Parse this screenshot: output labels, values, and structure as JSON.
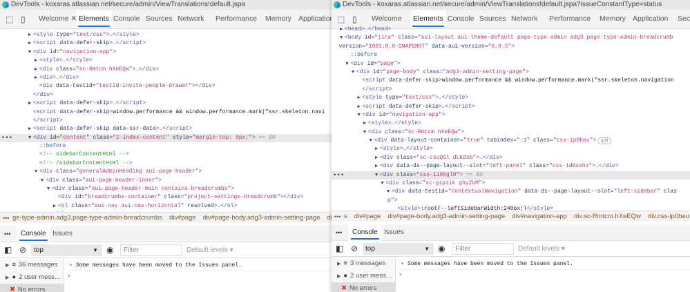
{
  "left": {
    "title": "DevTools - koxaras.atlassian.net/secure/admin/ViewTranslations!default.jspa",
    "tabs": [
      "Welcome",
      "Elements",
      "Console",
      "Sources",
      "Network",
      "Performance",
      "Memory",
      "Application"
    ],
    "active_tab": "Elements",
    "code": [
      {
        "d": 0,
        "a": "r",
        "t": [
          [
            "tag",
            "<style "
          ],
          [
            "attr",
            "type"
          ],
          [
            "tag",
            "=\""
          ],
          [
            "val",
            "text/css"
          ],
          [
            "tag",
            "\">…</style>"
          ]
        ]
      },
      {
        "d": 0,
        "a": "r",
        "t": [
          [
            "tag",
            "<script "
          ],
          [
            "attr",
            "data-defer-skip"
          ],
          [
            "tag",
            ">…</script>"
          ]
        ]
      },
      {
        "d": 0,
        "a": "d",
        "t": [
          [
            "tag",
            "<div "
          ],
          [
            "attr",
            "id"
          ],
          [
            "tag",
            "=\""
          ],
          [
            "val",
            "navigation-app"
          ],
          [
            "tag",
            "\">"
          ]
        ]
      },
      {
        "d": 1,
        "a": "r",
        "t": [
          [
            "tag",
            "<style>…</style>"
          ]
        ]
      },
      {
        "d": 1,
        "a": "r",
        "t": [
          [
            "tag",
            "<div "
          ],
          [
            "attr",
            "class"
          ],
          [
            "tag",
            "=\""
          ],
          [
            "val",
            "sc-Rmtcm hXeEQw"
          ],
          [
            "tag",
            "\">…</div>"
          ]
        ]
      },
      {
        "d": 1,
        "a": "r",
        "t": [
          [
            "tag",
            "<div>…</div>"
          ]
        ]
      },
      {
        "d": 1,
        "a": "",
        "t": [
          [
            "tag",
            "<div "
          ],
          [
            "attr",
            "data-testid"
          ],
          [
            "tag",
            "=\""
          ],
          [
            "val",
            "testId-invite-people-drawer"
          ],
          [
            "tag",
            "\"></div>"
          ]
        ]
      },
      {
        "d": 0,
        "a": "",
        "t": [
          [
            "tag",
            "</div>"
          ]
        ]
      },
      {
        "d": 0,
        "a": "r",
        "t": [
          [
            "tag",
            "<script "
          ],
          [
            "attr",
            "data-defer-skip"
          ],
          [
            "tag",
            ">…</script>"
          ]
        ]
      },
      {
        "d": 0,
        "a": "",
        "t": [
          [
            "tag",
            "<script "
          ],
          [
            "attr",
            "data-defer-skip"
          ],
          [
            "tag",
            ">"
          ],
          [
            "txt",
            "window.performance && window.performance.mark(\"ssr.skeleton.navi"
          ]
        ]
      },
      {
        "d": 0,
        "a": "",
        "t": [
          [
            "tag",
            "</script>"
          ]
        ]
      },
      {
        "d": 0,
        "a": "r",
        "t": [
          [
            "tag",
            "<script "
          ],
          [
            "attr",
            "data-defer-skip data-ssr-data"
          ],
          [
            "tag",
            ">…</script>"
          ]
        ]
      },
      {
        "d": 0,
        "a": "d",
        "sel": true,
        "t": [
          [
            "tag",
            "<div "
          ],
          [
            "attr",
            "id"
          ],
          [
            "tag",
            "=\""
          ],
          [
            "val",
            "content"
          ],
          [
            "tag",
            "\" "
          ],
          [
            "attr",
            "class"
          ],
          [
            "tag",
            "=\""
          ],
          [
            "val",
            "z-index-content"
          ],
          [
            "tag",
            "\" "
          ],
          [
            "attr",
            "style"
          ],
          [
            "tag",
            "=\""
          ],
          [
            "val",
            "margin-top: 0px;"
          ],
          [
            "tag",
            "\">"
          ],
          [
            "dim",
            " == $0"
          ]
        ]
      },
      {
        "d": 1,
        "a": "",
        "t": [
          [
            "ps",
            "::before"
          ]
        ]
      },
      {
        "d": 1,
        "a": "",
        "t": [
          [
            "cm",
            "<!-- sidebarContentHtml -->"
          ]
        ]
      },
      {
        "d": 1,
        "a": "",
        "t": [
          [
            "cm",
            "<!-- /sidebarContentHtml -->"
          ]
        ]
      },
      {
        "d": 1,
        "a": "d",
        "t": [
          [
            "tag",
            "<div "
          ],
          [
            "attr",
            "class"
          ],
          [
            "tag",
            "=\""
          ],
          [
            "val",
            "generalAdminHeading aui-page-header"
          ],
          [
            "tag",
            "\">"
          ]
        ]
      },
      {
        "d": 2,
        "a": "d",
        "t": [
          [
            "tag",
            "<div "
          ],
          [
            "attr",
            "class"
          ],
          [
            "tag",
            "=\""
          ],
          [
            "val",
            "aui-page-header-inner"
          ],
          [
            "tag",
            "\">"
          ]
        ]
      },
      {
        "d": 3,
        "a": "d",
        "t": [
          [
            "tag",
            "<div "
          ],
          [
            "attr",
            "class"
          ],
          [
            "tag",
            "=\""
          ],
          [
            "val",
            "aui-page-header-main contains-breadcrumbs"
          ],
          [
            "tag",
            "\">"
          ]
        ]
      },
      {
        "d": 4,
        "a": "",
        "t": [
          [
            "tag",
            "<div "
          ],
          [
            "attr",
            "id"
          ],
          [
            "tag",
            "=\""
          ],
          [
            "val",
            "breadcrumbs-container"
          ],
          [
            "tag",
            "\" "
          ],
          [
            "attr",
            "class"
          ],
          [
            "tag",
            "=\""
          ],
          [
            "val",
            "project-settings-breadcrumb"
          ],
          [
            "tag",
            "\"></div>"
          ]
        ]
      },
      {
        "d": 4,
        "a": "r",
        "t": [
          [
            "tag",
            "<ol "
          ],
          [
            "attr",
            "class"
          ],
          [
            "tag",
            "=\""
          ],
          [
            "val",
            "aui-nav aui-nav-horizontal"
          ],
          [
            "tag",
            "\" "
          ],
          [
            "attr",
            "resolved"
          ],
          [
            "tag",
            ">…</ol>"
          ]
        ]
      },
      {
        "d": 3,
        "a": "",
        "t": [
          [
            "tag",
            "</div>"
          ]
        ]
      }
    ],
    "breadcrumbs": [
      "ge-type-admin.adg3.page-type-admin-breadcrumbs",
      "div#page",
      "div#page-body.adg3-admin-setting-page",
      "div#c"
    ],
    "console_tabs": [
      "Console",
      "Issues"
    ],
    "context": "top",
    "filter_placeholder": "Filter",
    "levels": "Default levels ▾",
    "sidebar": [
      "36 messages",
      "2 user mess…",
      "No errors"
    ],
    "message": "Some messages have been moved to the Issues panel."
  },
  "right": {
    "title": "DevTools - koxaras.atlassian.net/secure/admin/ViewTranslations!default.jspa?issueConstantType=status",
    "tabs": [
      "Welcome",
      "Elements",
      "Console",
      "Sources",
      "Network",
      "Performance",
      "Memory",
      "Application",
      "Secu"
    ],
    "active_tab": "Elements",
    "code": [
      {
        "d": 0,
        "a": "r",
        "t": [
          [
            "tag",
            "<head>…</head>"
          ]
        ]
      },
      {
        "d": 0,
        "a": "d",
        "t": [
          [
            "tag",
            "<body "
          ],
          [
            "attr",
            "id"
          ],
          [
            "tag",
            "=\""
          ],
          [
            "val",
            "jira"
          ],
          [
            "tag",
            "\" "
          ],
          [
            "attr",
            "class"
          ],
          [
            "tag",
            "=\""
          ],
          [
            "val",
            "aui-layout aui-theme-default page-type-admin adg3  page-type-admin-breadcrumb"
          ]
        ]
      },
      {
        "d": -1,
        "a": "",
        "t": [
          [
            "attr",
            "version"
          ],
          [
            "tag",
            "=\""
          ],
          [
            "val",
            "1001.0.0-SNAPSHOT"
          ],
          [
            "tag",
            "\" "
          ],
          [
            "attr",
            "data-aui-version"
          ],
          [
            "tag",
            "=\""
          ],
          [
            "val",
            "6.0.5"
          ],
          [
            "tag",
            "\">"
          ]
        ]
      },
      {
        "d": 1,
        "a": "",
        "t": [
          [
            "ps",
            "::before"
          ]
        ]
      },
      {
        "d": 1,
        "a": "d",
        "t": [
          [
            "tag",
            "<div "
          ],
          [
            "attr",
            "id"
          ],
          [
            "tag",
            "=\""
          ],
          [
            "val",
            "page"
          ],
          [
            "tag",
            "\">"
          ]
        ]
      },
      {
        "d": 2,
        "a": "d",
        "t": [
          [
            "tag",
            "<div "
          ],
          [
            "attr",
            "id"
          ],
          [
            "tag",
            "=\""
          ],
          [
            "val",
            "page-body"
          ],
          [
            "tag",
            "\" "
          ],
          [
            "attr",
            "class"
          ],
          [
            "tag",
            "=\""
          ],
          [
            "val",
            "adg3-admin-setting-page"
          ],
          [
            "tag",
            "\">"
          ]
        ]
      },
      {
        "d": 3,
        "a": "",
        "t": [
          [
            "tag",
            "<script "
          ],
          [
            "attr",
            "data-defer-skip"
          ],
          [
            "tag",
            ">"
          ],
          [
            "txt",
            "window.performance && window.performance.mark(\"ssr.skeleton.navigation"
          ]
        ]
      },
      {
        "d": 3,
        "a": "",
        "t": [
          [
            "tag",
            "</script>"
          ]
        ]
      },
      {
        "d": 3,
        "a": "r",
        "t": [
          [
            "tag",
            "<style "
          ],
          [
            "attr",
            "type"
          ],
          [
            "tag",
            "=\""
          ],
          [
            "val",
            "text/css"
          ],
          [
            "tag",
            "\">…</style>"
          ]
        ]
      },
      {
        "d": 3,
        "a": "r",
        "t": [
          [
            "tag",
            "<script "
          ],
          [
            "attr",
            "data-defer-skip"
          ],
          [
            "tag",
            ">…</script>"
          ]
        ]
      },
      {
        "d": 3,
        "a": "d",
        "t": [
          [
            "tag",
            "<div "
          ],
          [
            "attr",
            "id"
          ],
          [
            "tag",
            "=\""
          ],
          [
            "val",
            "navigation-app"
          ],
          [
            "tag",
            "\">"
          ]
        ]
      },
      {
        "d": 4,
        "a": "r",
        "t": [
          [
            "tag",
            "<style>…</style>"
          ]
        ]
      },
      {
        "d": 4,
        "a": "d",
        "t": [
          [
            "tag",
            "<div "
          ],
          [
            "attr",
            "class"
          ],
          [
            "tag",
            "=\""
          ],
          [
            "val",
            "sc-Rmtcm hXeEQw"
          ],
          [
            "tag",
            "\">"
          ]
        ]
      },
      {
        "d": 5,
        "a": "d",
        "badge": "grid",
        "t": [
          [
            "tag",
            "<div "
          ],
          [
            "attr",
            "data-layout-container"
          ],
          [
            "tag",
            "=\""
          ],
          [
            "val",
            "true"
          ],
          [
            "tag",
            "\" "
          ],
          [
            "attr",
            "tabindex"
          ],
          [
            "tag",
            "=\""
          ],
          [
            "val",
            "-1"
          ],
          [
            "tag",
            "\" "
          ],
          [
            "attr",
            "class"
          ],
          [
            "tag",
            "=\""
          ],
          [
            "val",
            "css-ip0beu"
          ],
          [
            "tag",
            "\">"
          ]
        ]
      },
      {
        "d": 6,
        "a": "r",
        "t": [
          [
            "tag",
            "<style>…</style>"
          ]
        ]
      },
      {
        "d": 6,
        "a": "r",
        "t": [
          [
            "tag",
            "<div "
          ],
          [
            "attr",
            "class"
          ],
          [
            "tag",
            "=\""
          ],
          [
            "val",
            "sc-csuQGl dLKdsb"
          ],
          [
            "tag",
            "\">…</div>"
          ]
        ]
      },
      {
        "d": 6,
        "a": "r",
        "t": [
          [
            "tag",
            "<div "
          ],
          [
            "attr",
            "data-ds--page-layout--slot"
          ],
          [
            "tag",
            "=\""
          ],
          [
            "val",
            "left-panel"
          ],
          [
            "tag",
            "\" "
          ],
          [
            "attr",
            "class"
          ],
          [
            "tag",
            "=\""
          ],
          [
            "val",
            "css-1d8sshx"
          ],
          [
            "tag",
            "\">…</div>"
          ]
        ]
      },
      {
        "d": 6,
        "a": "d",
        "sel": true,
        "t": [
          [
            "tag",
            "<div "
          ],
          [
            "attr",
            "class"
          ],
          [
            "tag",
            "=\""
          ],
          [
            "val",
            "css-1196gl0"
          ],
          [
            "tag",
            "\">"
          ],
          [
            "dim",
            " == $0"
          ]
        ]
      },
      {
        "d": 7,
        "a": "d",
        "t": [
          [
            "tag",
            "<div "
          ],
          [
            "attr",
            "class"
          ],
          [
            "tag",
            "=\""
          ],
          [
            "val",
            "sc-gipzik ghyZUM"
          ],
          [
            "tag",
            "\">"
          ]
        ]
      },
      {
        "d": 8,
        "a": "d",
        "t": [
          [
            "tag",
            "<div "
          ],
          [
            "attr",
            "data-testid"
          ],
          [
            "tag",
            "=\""
          ],
          [
            "val",
            "ContextualNavigation"
          ],
          [
            "tag",
            "\" "
          ],
          [
            "attr",
            "data-ds--page-layout--slot"
          ],
          [
            "tag",
            "=\""
          ],
          [
            "val",
            "left-sidebar"
          ],
          [
            "tag",
            "\" "
          ],
          [
            "attr",
            "clas"
          ]
        ]
      },
      {
        "d": 7.3,
        "a": "",
        "t": [
          [
            "val",
            "p"
          ],
          [
            "tag",
            "\">"
          ]
        ]
      },
      {
        "d": 9,
        "a": "",
        "t": [
          [
            "tag",
            "<style>"
          ],
          [
            "txt",
            ":root{--leftSidebarWidth:240px;}"
          ],
          [
            "tag",
            "</style>"
          ]
        ]
      }
    ],
    "breadcrumbs": [
      "s",
      "div#page",
      "div#page-body.adg3-admin-setting-page",
      "div#navigation-app",
      "div.sc-Rmtcm.hXeEQw",
      "div.css-ip0beu",
      "d"
    ],
    "console_tabs": [
      "Console",
      "Issues"
    ],
    "context": "top",
    "filter_placeholder": "Filter",
    "levels": "Default levels ▾",
    "sidebar": [
      "3 messages",
      "2 user mess…",
      "No errors"
    ],
    "message": "Some messages have been moved to the Issues panel."
  }
}
